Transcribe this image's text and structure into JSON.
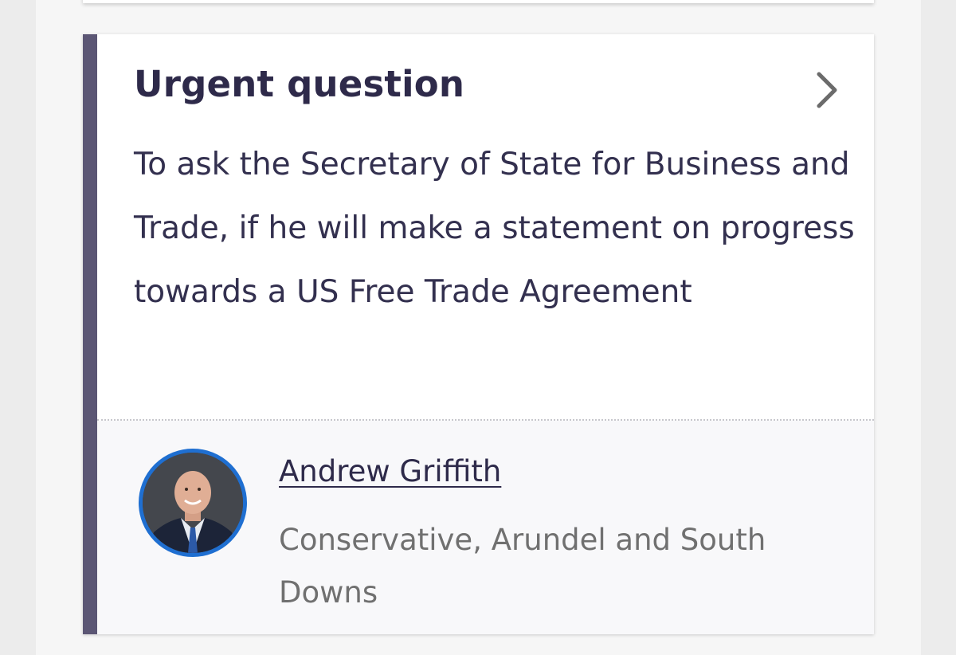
{
  "card": {
    "heading": "Urgent question",
    "question": "To ask the Secretary of State for Business and Trade, if he will make a statement on progress towards a US Free Trade Agreement",
    "accent_color": "#5b5674",
    "chevron_icon": "chevron-right-icon"
  },
  "member": {
    "name": "Andrew Griffith",
    "details": "Conservative, Arundel and South Downs",
    "avatar_icon": "member-portrait",
    "party_ring_color": "#1f6fd1"
  }
}
